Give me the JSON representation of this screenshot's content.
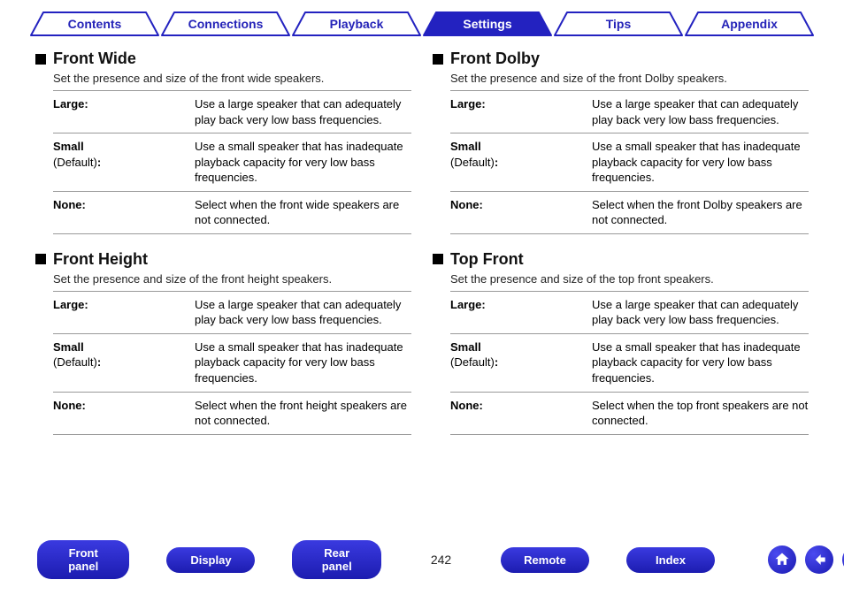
{
  "tabs": [
    {
      "label": "Contents",
      "active": false
    },
    {
      "label": "Connections",
      "active": false
    },
    {
      "label": "Playback",
      "active": false
    },
    {
      "label": "Settings",
      "active": true
    },
    {
      "label": "Tips",
      "active": false
    },
    {
      "label": "Appendix",
      "active": false
    }
  ],
  "sections": {
    "left": [
      {
        "title": "Front Wide",
        "desc": "Set the presence and size of the front wide speakers.",
        "rows": [
          {
            "label": "Large:",
            "default": "",
            "value": "Use a large speaker that can adequately play back very low bass frequencies."
          },
          {
            "label": "Small",
            "default": "(Default)",
            "colon": ":",
            "value": "Use a small speaker that has inadequate playback capacity for very low bass frequencies."
          },
          {
            "label": "None:",
            "default": "",
            "value": "Select when the front wide speakers are not connected."
          }
        ]
      },
      {
        "title": "Front Height",
        "desc": "Set the presence and size of the front height speakers.",
        "rows": [
          {
            "label": "Large:",
            "default": "",
            "value": "Use a large speaker that can adequately play back very low bass frequencies."
          },
          {
            "label": "Small",
            "default": "(Default)",
            "colon": ":",
            "value": "Use a small speaker that has inadequate playback capacity for very low bass frequencies."
          },
          {
            "label": "None:",
            "default": "",
            "value": "Select when the front height speakers are not connected."
          }
        ]
      }
    ],
    "right": [
      {
        "title": "Front Dolby",
        "desc": "Set the presence and size of the front Dolby speakers.",
        "rows": [
          {
            "label": "Large:",
            "default": "",
            "value": "Use a large speaker that can adequately play back very low bass frequencies."
          },
          {
            "label": "Small",
            "default": "(Default)",
            "colon": ":",
            "value": "Use a small speaker that has inadequate playback capacity for very low bass frequencies."
          },
          {
            "label": "None:",
            "default": "",
            "value": "Select when the front Dolby speakers are not connected."
          }
        ]
      },
      {
        "title": "Top Front",
        "desc": "Set the presence and size of the top front speakers.",
        "rows": [
          {
            "label": "Large:",
            "default": "",
            "value": "Use a large speaker that can adequately play back very low bass frequencies."
          },
          {
            "label": "Small",
            "default": "(Default)",
            "colon": ":",
            "value": "Use a small speaker that has inadequate playback capacity for very low bass frequencies."
          },
          {
            "label": "None:",
            "default": "",
            "value": "Select when the top front speakers are not connected."
          }
        ]
      }
    ]
  },
  "footer": {
    "buttons_left": [
      "Front panel",
      "Display",
      "Rear panel"
    ],
    "page": "242",
    "buttons_right": [
      "Remote",
      "Index"
    ]
  }
}
